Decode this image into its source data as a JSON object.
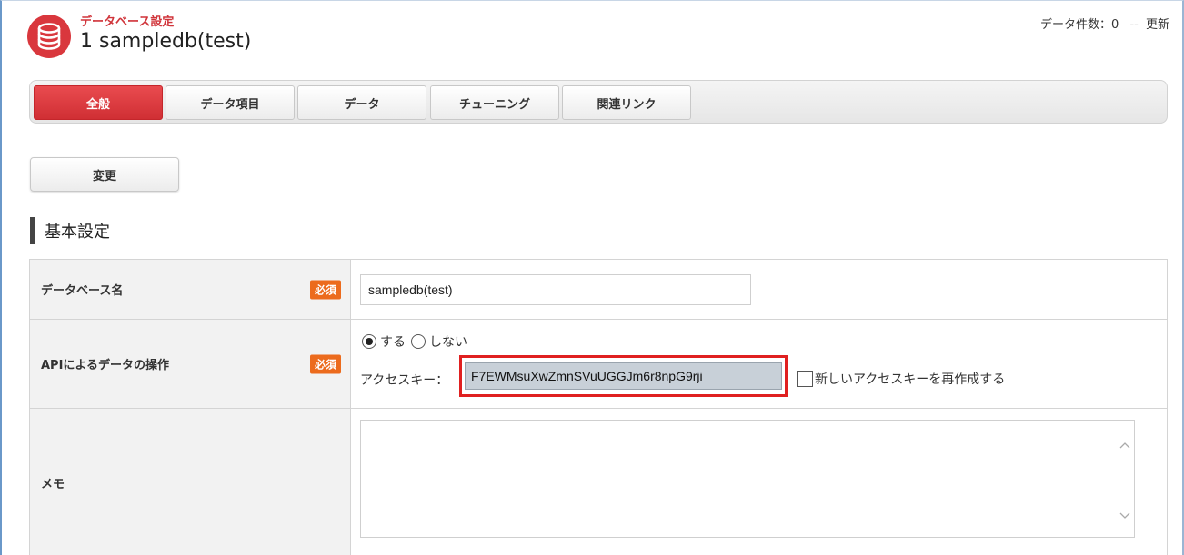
{
  "header": {
    "subtitle": "データベース設定",
    "title": "1 sampledb(test)",
    "record_count": "データ件数：0",
    "separator": "--",
    "refresh_label": "更新",
    "logo_icon": "database-icon"
  },
  "tabs": [
    {
      "label": "全般",
      "active": true
    },
    {
      "label": "データ項目",
      "active": false
    },
    {
      "label": "データ",
      "active": false
    },
    {
      "label": "チューニング",
      "active": false
    },
    {
      "label": "関連リンク",
      "active": false
    }
  ],
  "actions": {
    "change_label": "変更"
  },
  "section": {
    "title": "基本設定"
  },
  "form": {
    "db_name": {
      "label": "データベース名",
      "required": "必須",
      "value": "sampledb(test)"
    },
    "api": {
      "label": "APIによるデータの操作",
      "required": "必須",
      "option_yes": "する",
      "option_no": "しない",
      "selected": "する",
      "access_key_label": "アクセスキー：",
      "access_key_value": "F7EWMsuXwZmnSVuUGGJm6r8npG9rji",
      "regenerate_label": "新しいアクセスキーを再作成する",
      "regenerate_checked": false
    },
    "memo": {
      "label": "メモ",
      "value": ""
    }
  },
  "colors": {
    "accent": "#d9373d",
    "required_badge": "#ec6b1d",
    "highlight": "#e02020"
  }
}
